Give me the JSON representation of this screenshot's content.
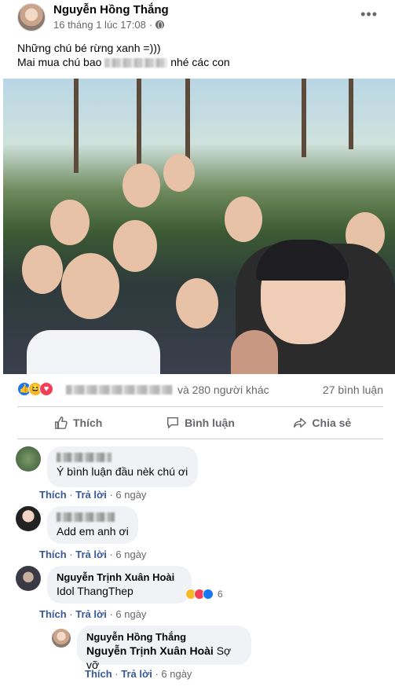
{
  "post": {
    "author": "Nguyễn Hồng Thắng",
    "timestamp": "16 tháng 1 lúc 17:08",
    "separator": "·",
    "more": "•••",
    "caption_line1": "Những chú bé rừng xanh =)))",
    "caption_line2_prefix": "Mai mua chú bao",
    "caption_line2_suffix": "nhé các con"
  },
  "reactions": {
    "others": "và 280 người khác",
    "comments": "27 bình luận",
    "colors": {
      "like": "#1877f2",
      "haha": "#f7b928",
      "love": "#f33e58"
    }
  },
  "actions": {
    "like": "Thích",
    "comment": "Bình luận",
    "share": "Chia sẻ"
  },
  "comments": [
    {
      "text": "Ý bình luận đầu nèk chú ơi",
      "like": "Thích",
      "reply": "Trả lời",
      "time": "6 ngày"
    },
    {
      "text": "Add em anh ơi",
      "like": "Thích",
      "reply": "Trả lời",
      "time": "6 ngày"
    },
    {
      "name": "Nguyễn Trịnh Xuân Hoài",
      "text": "Idol ThangThep",
      "like": "Thích",
      "reply": "Trả lời",
      "time": "6 ngày",
      "reaction_count": "6"
    }
  ],
  "reply": {
    "name": "Nguyễn Hồng Thắng",
    "mention": "Nguyễn Trịnh Xuân Hoài",
    "text": "Sợ vỡ",
    "like": "Thích",
    "reply": "Trả lời",
    "time": "6 ngày"
  }
}
